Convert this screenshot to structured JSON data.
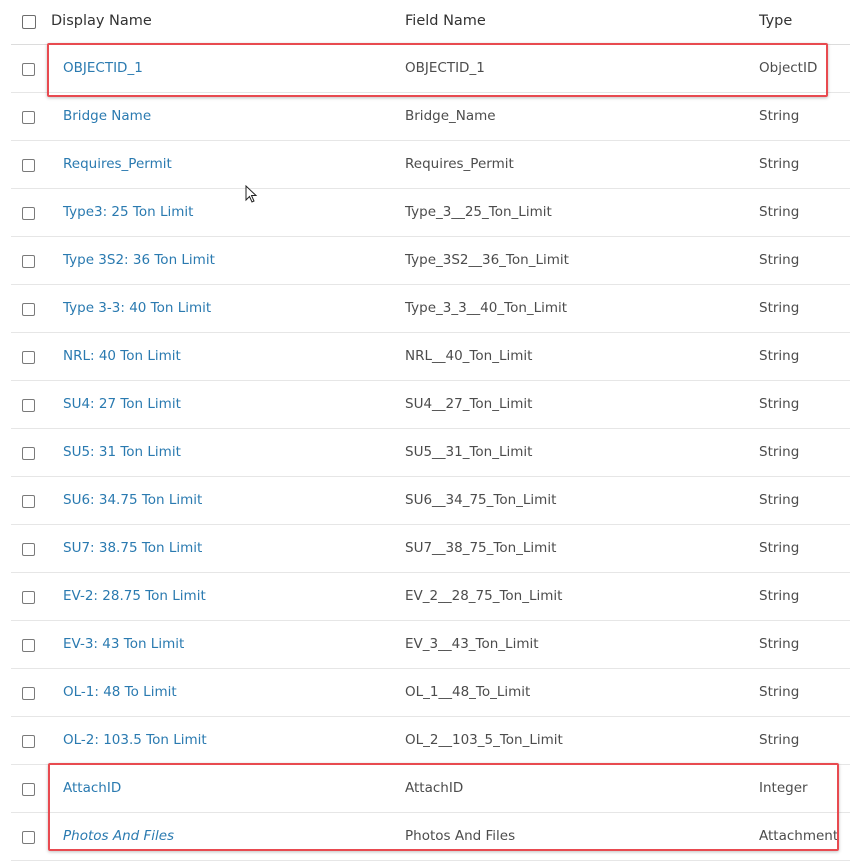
{
  "header": {
    "display_name": "Display Name",
    "field_name": "Field Name",
    "type": "Type"
  },
  "rows": [
    {
      "display": "OBJECTID_1",
      "field": "OBJECTID_1",
      "type": "ObjectID",
      "italic": false
    },
    {
      "display": "Bridge Name",
      "field": "Bridge_Name",
      "type": "String",
      "italic": false
    },
    {
      "display": "Requires_Permit",
      "field": "Requires_Permit",
      "type": "String",
      "italic": false
    },
    {
      "display": "Type3: 25 Ton Limit",
      "field": "Type_3__25_Ton_Limit",
      "type": "String",
      "italic": false
    },
    {
      "display": "Type 3S2: 36 Ton Limit",
      "field": "Type_3S2__36_Ton_Limit",
      "type": "String",
      "italic": false
    },
    {
      "display": "Type 3-3: 40 Ton Limit",
      "field": "Type_3_3__40_Ton_Limit",
      "type": "String",
      "italic": false
    },
    {
      "display": "NRL: 40 Ton Limit",
      "field": "NRL__40_Ton_Limit",
      "type": "String",
      "italic": false
    },
    {
      "display": "SU4: 27 Ton Limit",
      "field": "SU4__27_Ton_Limit",
      "type": "String",
      "italic": false
    },
    {
      "display": "SU5: 31 Ton Limit",
      "field": "SU5__31_Ton_Limit",
      "type": "String",
      "italic": false
    },
    {
      "display": "SU6: 34.75 Ton Limit",
      "field": "SU6__34_75_Ton_Limit",
      "type": "String",
      "italic": false
    },
    {
      "display": "SU7: 38.75 Ton Limit",
      "field": "SU7__38_75_Ton_Limit",
      "type": "String",
      "italic": false
    },
    {
      "display": "EV-2: 28.75 Ton Limit",
      "field": "EV_2__28_75_Ton_Limit",
      "type": "String",
      "italic": false
    },
    {
      "display": "EV-3: 43 Ton Limit",
      "field": "EV_3__43_Ton_Limit",
      "type": "String",
      "italic": false
    },
    {
      "display": "OL-1: 48 To Limit",
      "field": "OL_1__48_To_Limit",
      "type": "String",
      "italic": false
    },
    {
      "display": "OL-2: 103.5 Ton Limit",
      "field": "OL_2__103_5_Ton_Limit",
      "type": "String",
      "italic": false
    },
    {
      "display": "AttachID",
      "field": "AttachID",
      "type": "Integer",
      "italic": false
    },
    {
      "display": "Photos And Files",
      "field": "Photos And Files",
      "type": "Attachment",
      "italic": true
    }
  ],
  "colors": {
    "link": "#2a7ab0",
    "highlight": "#e84a50",
    "text": "#4c4c4c"
  }
}
